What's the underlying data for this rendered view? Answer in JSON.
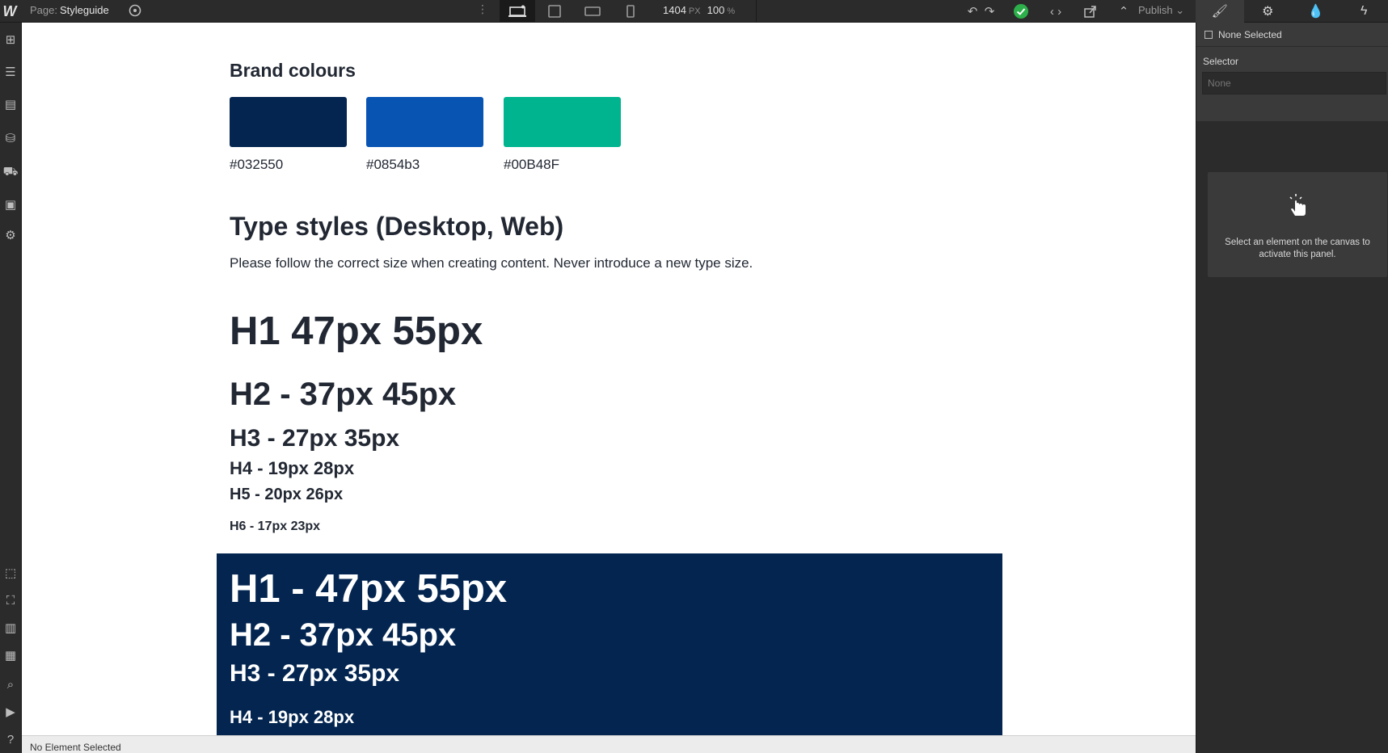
{
  "topbar": {
    "logo": "W",
    "page_label": "Page:",
    "page_name": "Styleguide",
    "width_value": "1404",
    "width_unit": "PX",
    "zoom_value": "100",
    "zoom_unit": "%",
    "publish_label": "Publish"
  },
  "canvas": {
    "brand_heading": "Brand colours",
    "swatches": [
      {
        "hex": "#032550",
        "label": "#032550"
      },
      {
        "hex": "#0854b3",
        "label": "#0854b3"
      },
      {
        "hex": "#00B48F",
        "label": "#00B48F"
      }
    ],
    "type_heading": "Type styles (Desktop, Web)",
    "intro": "Please follow the correct size when creating content. Never introduce a new type size.",
    "light_samples": {
      "h1": "H1 47px 55px",
      "h2": "H2 - 37px 45px",
      "h3": "H3 - 27px 35px",
      "h4": "H4 - 19px 28px",
      "h5": "H5 - 20px 26px",
      "h6": "H6 - 17px 23px"
    },
    "dark_samples": {
      "h1": "H1 -  47px 55px",
      "h2": "H2 - 37px 45px",
      "h3": "H3 -  27px 35px",
      "h4": "H4 - 19px 28px"
    }
  },
  "statusbar": {
    "text": "No Element Selected"
  },
  "right_panel": {
    "none_selected": "None Selected",
    "selector_label": "Selector",
    "selector_placeholder": "None",
    "hint": "Select an element on the canvas to activate this panel."
  },
  "colors": {
    "navy": "#032550",
    "blue": "#0854b3",
    "green": "#00B48F",
    "published_ok": "#2db04b"
  }
}
